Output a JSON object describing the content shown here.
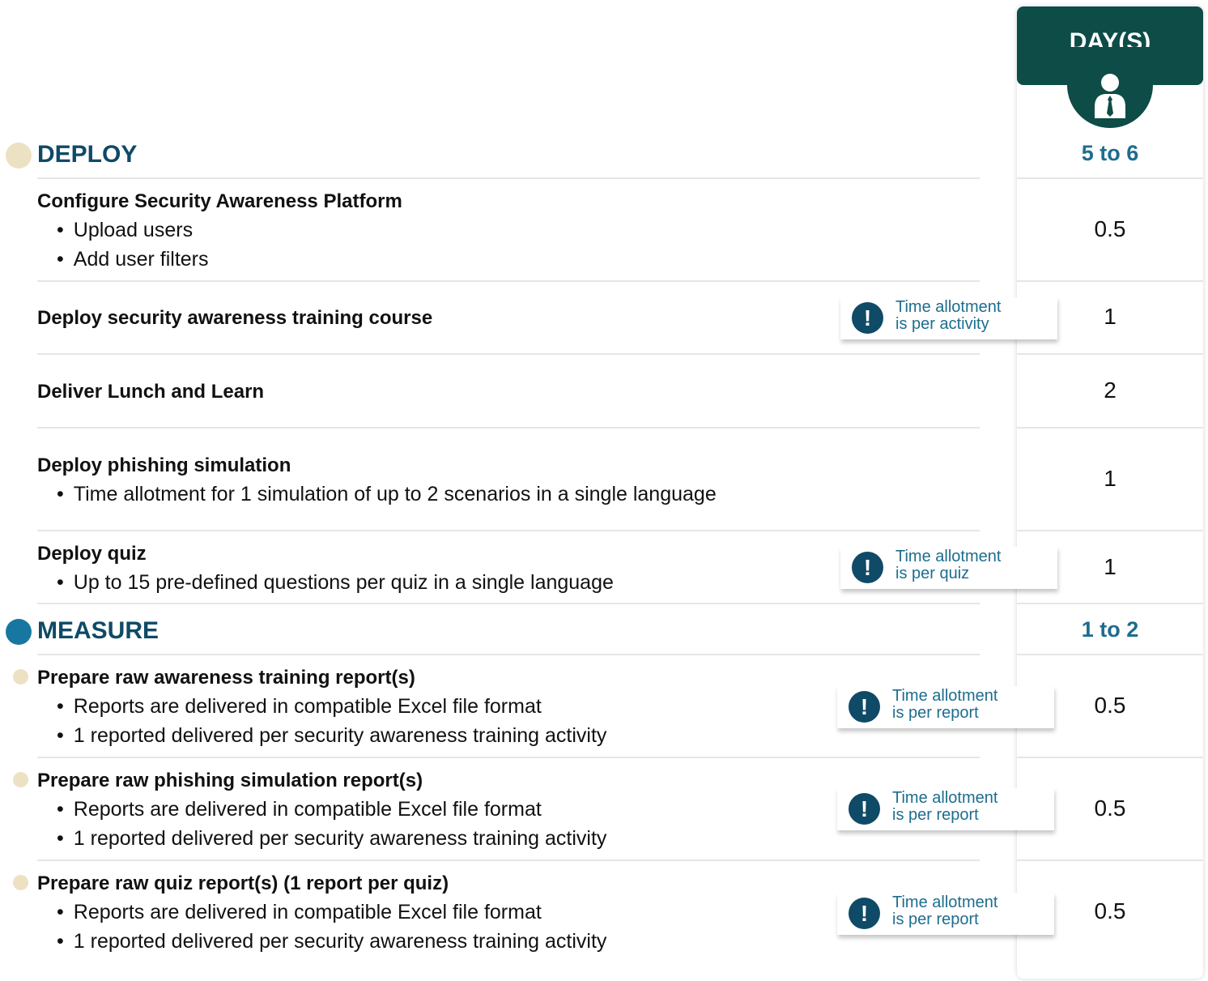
{
  "header": {
    "days_label": "DAY(S)"
  },
  "colors": {
    "dark_teal": "#0d4c47",
    "navy": "#0f4a67",
    "blue": "#1d6d8e",
    "tan": "#ede1c4",
    "measure_dot": "#1877a0"
  },
  "icons": {
    "header": "person-with-tie-icon",
    "note": "exclamation-icon"
  },
  "phases": [
    {
      "title": "DEPLOY",
      "days": "5 to 6"
    },
    {
      "title": "MEASURE",
      "days": "1 to 2"
    }
  ],
  "rows": [
    {
      "title": "Configure Security Awareness Platform",
      "bullets": [
        "Upload users",
        "Add user filters"
      ],
      "days": "0.5"
    },
    {
      "title": "Deploy security awareness training course",
      "bullets": [],
      "days": "1",
      "note": [
        "Time allotment",
        "is per activity"
      ]
    },
    {
      "title": "Deliver Lunch and Learn",
      "bullets": [],
      "days": "2"
    },
    {
      "title": "Deploy phishing simulation",
      "bullets": [
        "Time allotment for 1 simulation of up to 2 scenarios in a single language"
      ],
      "days": "1"
    },
    {
      "title": "Deploy quiz",
      "bullets": [
        "Up to 15 pre-defined questions per quiz in a single language"
      ],
      "days": "1",
      "note": [
        "Time allotment",
        "is per quiz"
      ]
    },
    {
      "title": "Prepare raw awareness training report(s)",
      "bullets": [
        "Reports are delivered in compatible Excel file format",
        "1 reported delivered per security awareness training activity"
      ],
      "days": "0.5",
      "note": [
        "Time allotment",
        "is per report"
      ]
    },
    {
      "title": "Prepare raw phishing simulation report(s)",
      "bullets": [
        "Reports are delivered in compatible Excel file format",
        "1 reported delivered per security awareness training activity"
      ],
      "days": "0.5",
      "note": [
        "Time allotment",
        "is per report"
      ]
    },
    {
      "title": "Prepare raw quiz report(s) (1 report per quiz)",
      "bullets": [
        "Reports are delivered in compatible Excel file format",
        "1 reported delivered per security awareness training activity"
      ],
      "days": "0.5",
      "note": [
        "Time allotment",
        "is per report"
      ]
    }
  ]
}
